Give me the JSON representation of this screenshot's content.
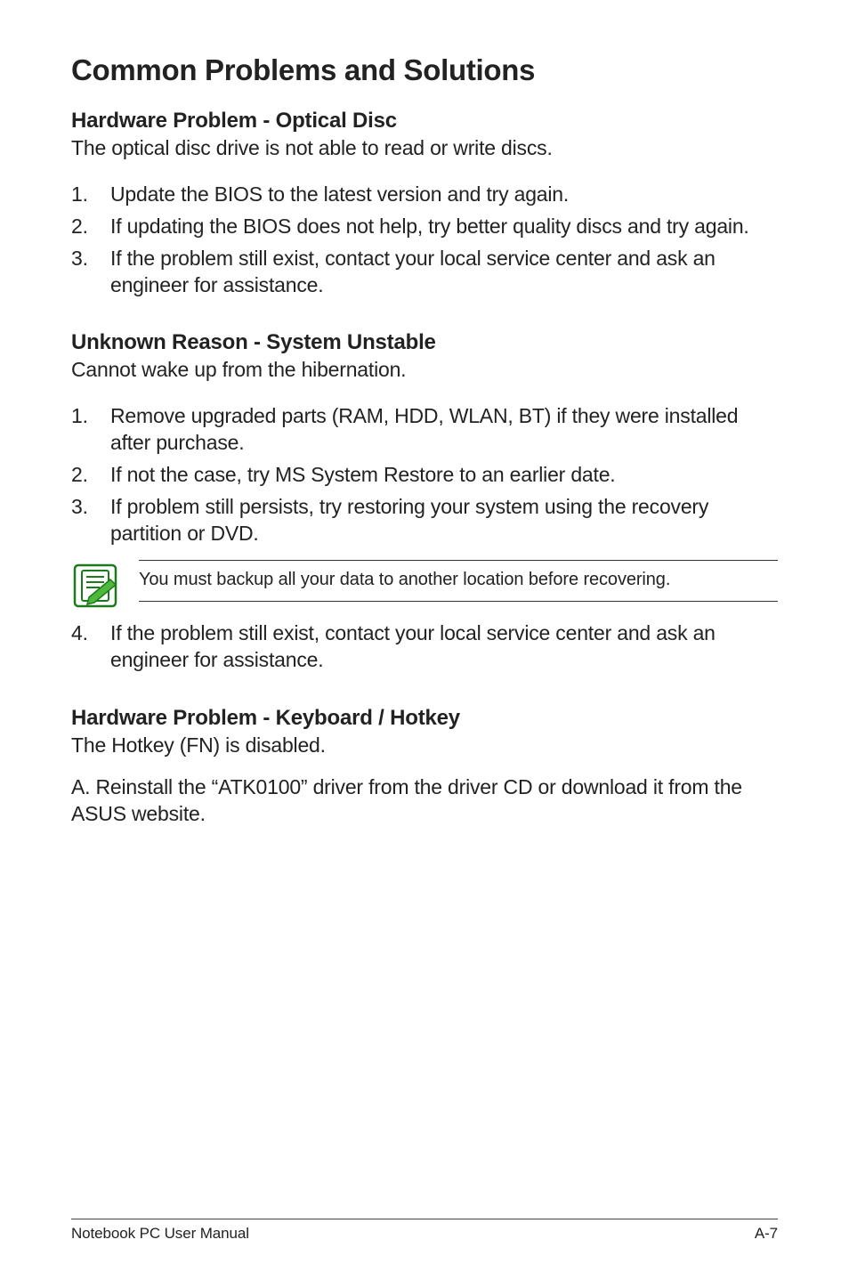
{
  "heading": "Common Problems and Solutions",
  "sections": [
    {
      "title": "Hardware Problem - Optical Disc",
      "intro": "The optical disc drive is not able to read or write discs.",
      "items": [
        "Update the BIOS to the latest version and try again.",
        "If updating the BIOS does not help, try better quality discs and try again.",
        "If the problem still exist, contact your local service center and ask an engineer for assistance."
      ]
    },
    {
      "title": "Unknown Reason - System Unstable",
      "intro": "Cannot wake up from the hibernation.",
      "items": [
        "Remove upgraded parts (RAM, HDD, WLAN, BT) if they were installed after purchase.",
        "If not the case, try MS System Restore to an earlier date.",
        "If problem still persists, try restoring your system using the recovery partition or DVD."
      ],
      "note": "You must backup all your data to another location before recovering.",
      "post_items": [
        {
          "num": "4.",
          "text": "If the problem still exist, contact your local service center and ask an engineer for assistance."
        }
      ]
    },
    {
      "title": "Hardware Problem - Keyboard / Hotkey",
      "intro": "The Hotkey (FN) is disabled.",
      "body": "A. Reinstall the “ATK0100” driver from the driver CD or download it from the ASUS website."
    }
  ],
  "footer": {
    "left": "Notebook PC User Manual",
    "right": "A-7"
  }
}
